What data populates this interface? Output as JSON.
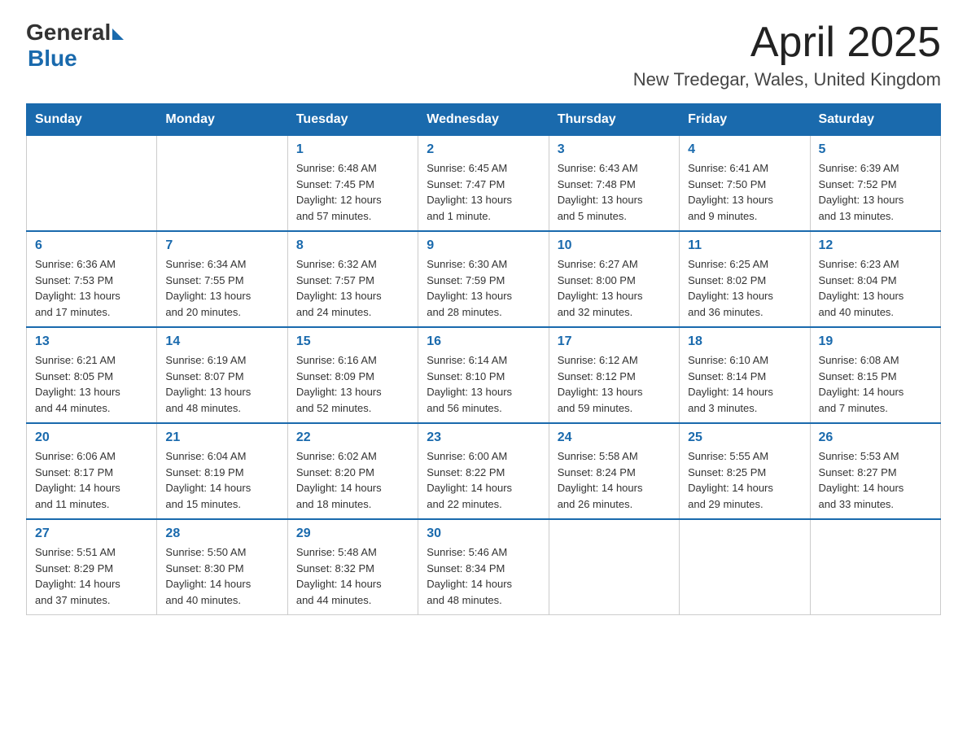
{
  "header": {
    "logo_general": "General",
    "logo_blue": "Blue",
    "month_title": "April 2025",
    "location": "New Tredegar, Wales, United Kingdom"
  },
  "weekdays": [
    "Sunday",
    "Monday",
    "Tuesday",
    "Wednesday",
    "Thursday",
    "Friday",
    "Saturday"
  ],
  "weeks": [
    [
      {
        "day": "",
        "info": ""
      },
      {
        "day": "",
        "info": ""
      },
      {
        "day": "1",
        "info": "Sunrise: 6:48 AM\nSunset: 7:45 PM\nDaylight: 12 hours\nand 57 minutes."
      },
      {
        "day": "2",
        "info": "Sunrise: 6:45 AM\nSunset: 7:47 PM\nDaylight: 13 hours\nand 1 minute."
      },
      {
        "day": "3",
        "info": "Sunrise: 6:43 AM\nSunset: 7:48 PM\nDaylight: 13 hours\nand 5 minutes."
      },
      {
        "day": "4",
        "info": "Sunrise: 6:41 AM\nSunset: 7:50 PM\nDaylight: 13 hours\nand 9 minutes."
      },
      {
        "day": "5",
        "info": "Sunrise: 6:39 AM\nSunset: 7:52 PM\nDaylight: 13 hours\nand 13 minutes."
      }
    ],
    [
      {
        "day": "6",
        "info": "Sunrise: 6:36 AM\nSunset: 7:53 PM\nDaylight: 13 hours\nand 17 minutes."
      },
      {
        "day": "7",
        "info": "Sunrise: 6:34 AM\nSunset: 7:55 PM\nDaylight: 13 hours\nand 20 minutes."
      },
      {
        "day": "8",
        "info": "Sunrise: 6:32 AM\nSunset: 7:57 PM\nDaylight: 13 hours\nand 24 minutes."
      },
      {
        "day": "9",
        "info": "Sunrise: 6:30 AM\nSunset: 7:59 PM\nDaylight: 13 hours\nand 28 minutes."
      },
      {
        "day": "10",
        "info": "Sunrise: 6:27 AM\nSunset: 8:00 PM\nDaylight: 13 hours\nand 32 minutes."
      },
      {
        "day": "11",
        "info": "Sunrise: 6:25 AM\nSunset: 8:02 PM\nDaylight: 13 hours\nand 36 minutes."
      },
      {
        "day": "12",
        "info": "Sunrise: 6:23 AM\nSunset: 8:04 PM\nDaylight: 13 hours\nand 40 minutes."
      }
    ],
    [
      {
        "day": "13",
        "info": "Sunrise: 6:21 AM\nSunset: 8:05 PM\nDaylight: 13 hours\nand 44 minutes."
      },
      {
        "day": "14",
        "info": "Sunrise: 6:19 AM\nSunset: 8:07 PM\nDaylight: 13 hours\nand 48 minutes."
      },
      {
        "day": "15",
        "info": "Sunrise: 6:16 AM\nSunset: 8:09 PM\nDaylight: 13 hours\nand 52 minutes."
      },
      {
        "day": "16",
        "info": "Sunrise: 6:14 AM\nSunset: 8:10 PM\nDaylight: 13 hours\nand 56 minutes."
      },
      {
        "day": "17",
        "info": "Sunrise: 6:12 AM\nSunset: 8:12 PM\nDaylight: 13 hours\nand 59 minutes."
      },
      {
        "day": "18",
        "info": "Sunrise: 6:10 AM\nSunset: 8:14 PM\nDaylight: 14 hours\nand 3 minutes."
      },
      {
        "day": "19",
        "info": "Sunrise: 6:08 AM\nSunset: 8:15 PM\nDaylight: 14 hours\nand 7 minutes."
      }
    ],
    [
      {
        "day": "20",
        "info": "Sunrise: 6:06 AM\nSunset: 8:17 PM\nDaylight: 14 hours\nand 11 minutes."
      },
      {
        "day": "21",
        "info": "Sunrise: 6:04 AM\nSunset: 8:19 PM\nDaylight: 14 hours\nand 15 minutes."
      },
      {
        "day": "22",
        "info": "Sunrise: 6:02 AM\nSunset: 8:20 PM\nDaylight: 14 hours\nand 18 minutes."
      },
      {
        "day": "23",
        "info": "Sunrise: 6:00 AM\nSunset: 8:22 PM\nDaylight: 14 hours\nand 22 minutes."
      },
      {
        "day": "24",
        "info": "Sunrise: 5:58 AM\nSunset: 8:24 PM\nDaylight: 14 hours\nand 26 minutes."
      },
      {
        "day": "25",
        "info": "Sunrise: 5:55 AM\nSunset: 8:25 PM\nDaylight: 14 hours\nand 29 minutes."
      },
      {
        "day": "26",
        "info": "Sunrise: 5:53 AM\nSunset: 8:27 PM\nDaylight: 14 hours\nand 33 minutes."
      }
    ],
    [
      {
        "day": "27",
        "info": "Sunrise: 5:51 AM\nSunset: 8:29 PM\nDaylight: 14 hours\nand 37 minutes."
      },
      {
        "day": "28",
        "info": "Sunrise: 5:50 AM\nSunset: 8:30 PM\nDaylight: 14 hours\nand 40 minutes."
      },
      {
        "day": "29",
        "info": "Sunrise: 5:48 AM\nSunset: 8:32 PM\nDaylight: 14 hours\nand 44 minutes."
      },
      {
        "day": "30",
        "info": "Sunrise: 5:46 AM\nSunset: 8:34 PM\nDaylight: 14 hours\nand 48 minutes."
      },
      {
        "day": "",
        "info": ""
      },
      {
        "day": "",
        "info": ""
      },
      {
        "day": "",
        "info": ""
      }
    ]
  ]
}
